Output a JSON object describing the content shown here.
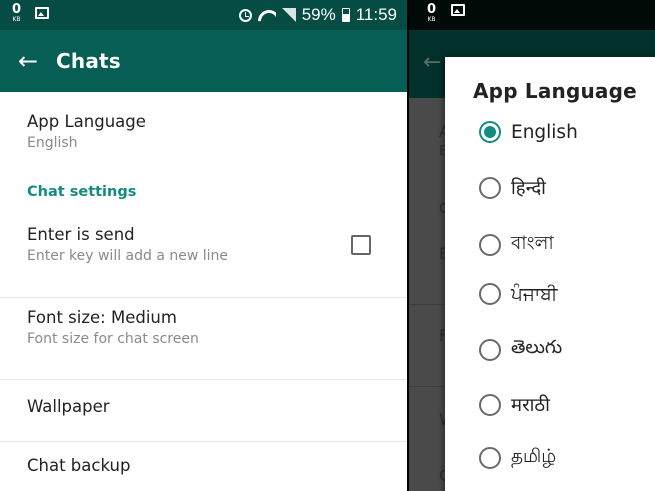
{
  "left_status": {
    "kb_value": "0",
    "kb_unit": "KB",
    "battery": "59%",
    "time": "11:59"
  },
  "app_bar": {
    "title": "Chats"
  },
  "settings": {
    "app_language": {
      "title": "App Language",
      "value": "English"
    },
    "section_header": "Chat settings",
    "enter_is_send": {
      "title": "Enter is send",
      "subtitle": "Enter key will add a new line",
      "checked": false
    },
    "font_size": {
      "title": "Font size: Medium",
      "subtitle": "Font size for chat screen"
    },
    "wallpaper": {
      "title": "Wallpaper"
    },
    "chat_backup": {
      "title": "Chat backup"
    }
  },
  "right_status": {
    "kb_value": "0",
    "kb_unit": "KB"
  },
  "background_fragments": [
    "A",
    "E",
    "C",
    "E",
    "F",
    "W",
    "C"
  ],
  "dialog": {
    "title": "App Language",
    "options": [
      {
        "label": "English",
        "selected": true
      },
      {
        "label": "हिन्दी",
        "selected": false
      },
      {
        "label": "বাংলা",
        "selected": false
      },
      {
        "label": "ਪੰਜਾਬੀ",
        "selected": false
      },
      {
        "label": "తెలుగు",
        "selected": false
      },
      {
        "label": "मराठी",
        "selected": false
      },
      {
        "label": "தமிழ்",
        "selected": false
      }
    ]
  },
  "colors": {
    "status_bar": "#054d44",
    "app_bar": "#075e54",
    "accent": "#128c7e"
  }
}
